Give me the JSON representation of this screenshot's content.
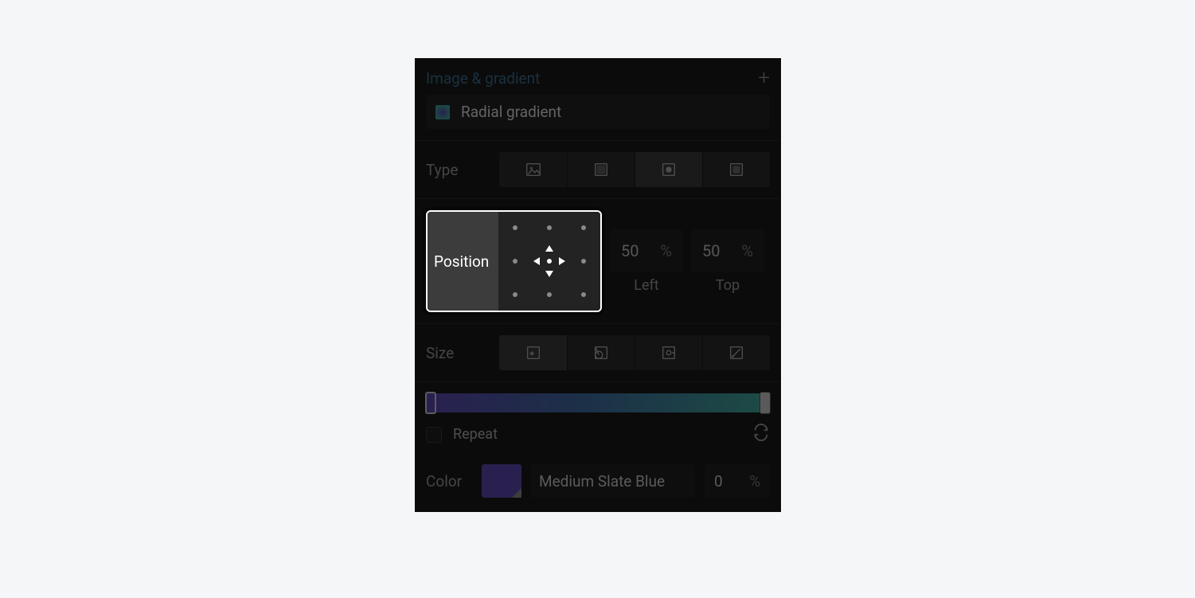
{
  "section": {
    "title": "Image & gradient"
  },
  "item": {
    "label": "Radial gradient"
  },
  "type": {
    "label": "Type",
    "selectedIndex": 2
  },
  "position": {
    "label": "Position",
    "left": {
      "value": "50",
      "unit": "%",
      "label": "Left"
    },
    "top": {
      "value": "50",
      "unit": "%",
      "label": "Top"
    }
  },
  "size": {
    "label": "Size",
    "selectedIndex": 0
  },
  "repeat": {
    "label": "Repeat",
    "checked": false
  },
  "gradient": {
    "stops": [
      {
        "position": 0,
        "color": "#5b48b0"
      },
      {
        "position": 100,
        "color": "#3ea89a"
      }
    ]
  },
  "color": {
    "label": "Color",
    "name": "Medium Slate Blue",
    "value": "0",
    "unit": "%",
    "swatch": "#5b48b0"
  }
}
